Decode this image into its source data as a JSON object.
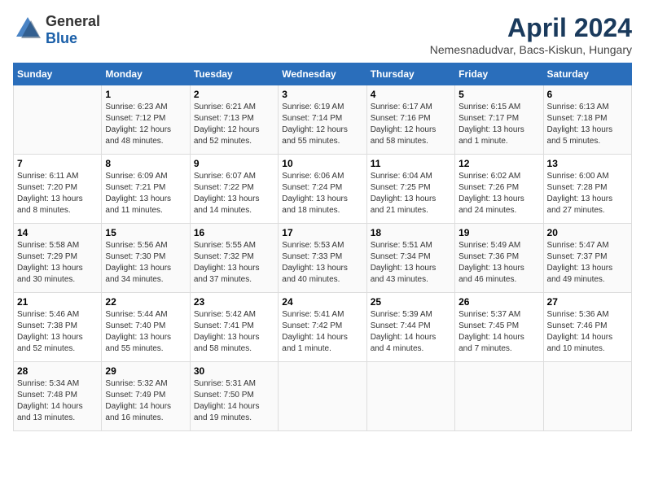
{
  "logo": {
    "text_general": "General",
    "text_blue": "Blue"
  },
  "calendar": {
    "title": "April 2024",
    "subtitle": "Nemesnadudvar, Bacs-Kiskun, Hungary"
  },
  "weekdays": [
    "Sunday",
    "Monday",
    "Tuesday",
    "Wednesday",
    "Thursday",
    "Friday",
    "Saturday"
  ],
  "weeks": [
    [
      {
        "day": "",
        "sunrise": "",
        "sunset": "",
        "daylight": ""
      },
      {
        "day": "1",
        "sunrise": "Sunrise: 6:23 AM",
        "sunset": "Sunset: 7:12 PM",
        "daylight": "Daylight: 12 hours and 48 minutes."
      },
      {
        "day": "2",
        "sunrise": "Sunrise: 6:21 AM",
        "sunset": "Sunset: 7:13 PM",
        "daylight": "Daylight: 12 hours and 52 minutes."
      },
      {
        "day": "3",
        "sunrise": "Sunrise: 6:19 AM",
        "sunset": "Sunset: 7:14 PM",
        "daylight": "Daylight: 12 hours and 55 minutes."
      },
      {
        "day": "4",
        "sunrise": "Sunrise: 6:17 AM",
        "sunset": "Sunset: 7:16 PM",
        "daylight": "Daylight: 12 hours and 58 minutes."
      },
      {
        "day": "5",
        "sunrise": "Sunrise: 6:15 AM",
        "sunset": "Sunset: 7:17 PM",
        "daylight": "Daylight: 13 hours and 1 minute."
      },
      {
        "day": "6",
        "sunrise": "Sunrise: 6:13 AM",
        "sunset": "Sunset: 7:18 PM",
        "daylight": "Daylight: 13 hours and 5 minutes."
      }
    ],
    [
      {
        "day": "7",
        "sunrise": "Sunrise: 6:11 AM",
        "sunset": "Sunset: 7:20 PM",
        "daylight": "Daylight: 13 hours and 8 minutes."
      },
      {
        "day": "8",
        "sunrise": "Sunrise: 6:09 AM",
        "sunset": "Sunset: 7:21 PM",
        "daylight": "Daylight: 13 hours and 11 minutes."
      },
      {
        "day": "9",
        "sunrise": "Sunrise: 6:07 AM",
        "sunset": "Sunset: 7:22 PM",
        "daylight": "Daylight: 13 hours and 14 minutes."
      },
      {
        "day": "10",
        "sunrise": "Sunrise: 6:06 AM",
        "sunset": "Sunset: 7:24 PM",
        "daylight": "Daylight: 13 hours and 18 minutes."
      },
      {
        "day": "11",
        "sunrise": "Sunrise: 6:04 AM",
        "sunset": "Sunset: 7:25 PM",
        "daylight": "Daylight: 13 hours and 21 minutes."
      },
      {
        "day": "12",
        "sunrise": "Sunrise: 6:02 AM",
        "sunset": "Sunset: 7:26 PM",
        "daylight": "Daylight: 13 hours and 24 minutes."
      },
      {
        "day": "13",
        "sunrise": "Sunrise: 6:00 AM",
        "sunset": "Sunset: 7:28 PM",
        "daylight": "Daylight: 13 hours and 27 minutes."
      }
    ],
    [
      {
        "day": "14",
        "sunrise": "Sunrise: 5:58 AM",
        "sunset": "Sunset: 7:29 PM",
        "daylight": "Daylight: 13 hours and 30 minutes."
      },
      {
        "day": "15",
        "sunrise": "Sunrise: 5:56 AM",
        "sunset": "Sunset: 7:30 PM",
        "daylight": "Daylight: 13 hours and 34 minutes."
      },
      {
        "day": "16",
        "sunrise": "Sunrise: 5:55 AM",
        "sunset": "Sunset: 7:32 PM",
        "daylight": "Daylight: 13 hours and 37 minutes."
      },
      {
        "day": "17",
        "sunrise": "Sunrise: 5:53 AM",
        "sunset": "Sunset: 7:33 PM",
        "daylight": "Daylight: 13 hours and 40 minutes."
      },
      {
        "day": "18",
        "sunrise": "Sunrise: 5:51 AM",
        "sunset": "Sunset: 7:34 PM",
        "daylight": "Daylight: 13 hours and 43 minutes."
      },
      {
        "day": "19",
        "sunrise": "Sunrise: 5:49 AM",
        "sunset": "Sunset: 7:36 PM",
        "daylight": "Daylight: 13 hours and 46 minutes."
      },
      {
        "day": "20",
        "sunrise": "Sunrise: 5:47 AM",
        "sunset": "Sunset: 7:37 PM",
        "daylight": "Daylight: 13 hours and 49 minutes."
      }
    ],
    [
      {
        "day": "21",
        "sunrise": "Sunrise: 5:46 AM",
        "sunset": "Sunset: 7:38 PM",
        "daylight": "Daylight: 13 hours and 52 minutes."
      },
      {
        "day": "22",
        "sunrise": "Sunrise: 5:44 AM",
        "sunset": "Sunset: 7:40 PM",
        "daylight": "Daylight: 13 hours and 55 minutes."
      },
      {
        "day": "23",
        "sunrise": "Sunrise: 5:42 AM",
        "sunset": "Sunset: 7:41 PM",
        "daylight": "Daylight: 13 hours and 58 minutes."
      },
      {
        "day": "24",
        "sunrise": "Sunrise: 5:41 AM",
        "sunset": "Sunset: 7:42 PM",
        "daylight": "Daylight: 14 hours and 1 minute."
      },
      {
        "day": "25",
        "sunrise": "Sunrise: 5:39 AM",
        "sunset": "Sunset: 7:44 PM",
        "daylight": "Daylight: 14 hours and 4 minutes."
      },
      {
        "day": "26",
        "sunrise": "Sunrise: 5:37 AM",
        "sunset": "Sunset: 7:45 PM",
        "daylight": "Daylight: 14 hours and 7 minutes."
      },
      {
        "day": "27",
        "sunrise": "Sunrise: 5:36 AM",
        "sunset": "Sunset: 7:46 PM",
        "daylight": "Daylight: 14 hours and 10 minutes."
      }
    ],
    [
      {
        "day": "28",
        "sunrise": "Sunrise: 5:34 AM",
        "sunset": "Sunset: 7:48 PM",
        "daylight": "Daylight: 14 hours and 13 minutes."
      },
      {
        "day": "29",
        "sunrise": "Sunrise: 5:32 AM",
        "sunset": "Sunset: 7:49 PM",
        "daylight": "Daylight: 14 hours and 16 minutes."
      },
      {
        "day": "30",
        "sunrise": "Sunrise: 5:31 AM",
        "sunset": "Sunset: 7:50 PM",
        "daylight": "Daylight: 14 hours and 19 minutes."
      },
      {
        "day": "",
        "sunrise": "",
        "sunset": "",
        "daylight": ""
      },
      {
        "day": "",
        "sunrise": "",
        "sunset": "",
        "daylight": ""
      },
      {
        "day": "",
        "sunrise": "",
        "sunset": "",
        "daylight": ""
      },
      {
        "day": "",
        "sunrise": "",
        "sunset": "",
        "daylight": ""
      }
    ]
  ]
}
